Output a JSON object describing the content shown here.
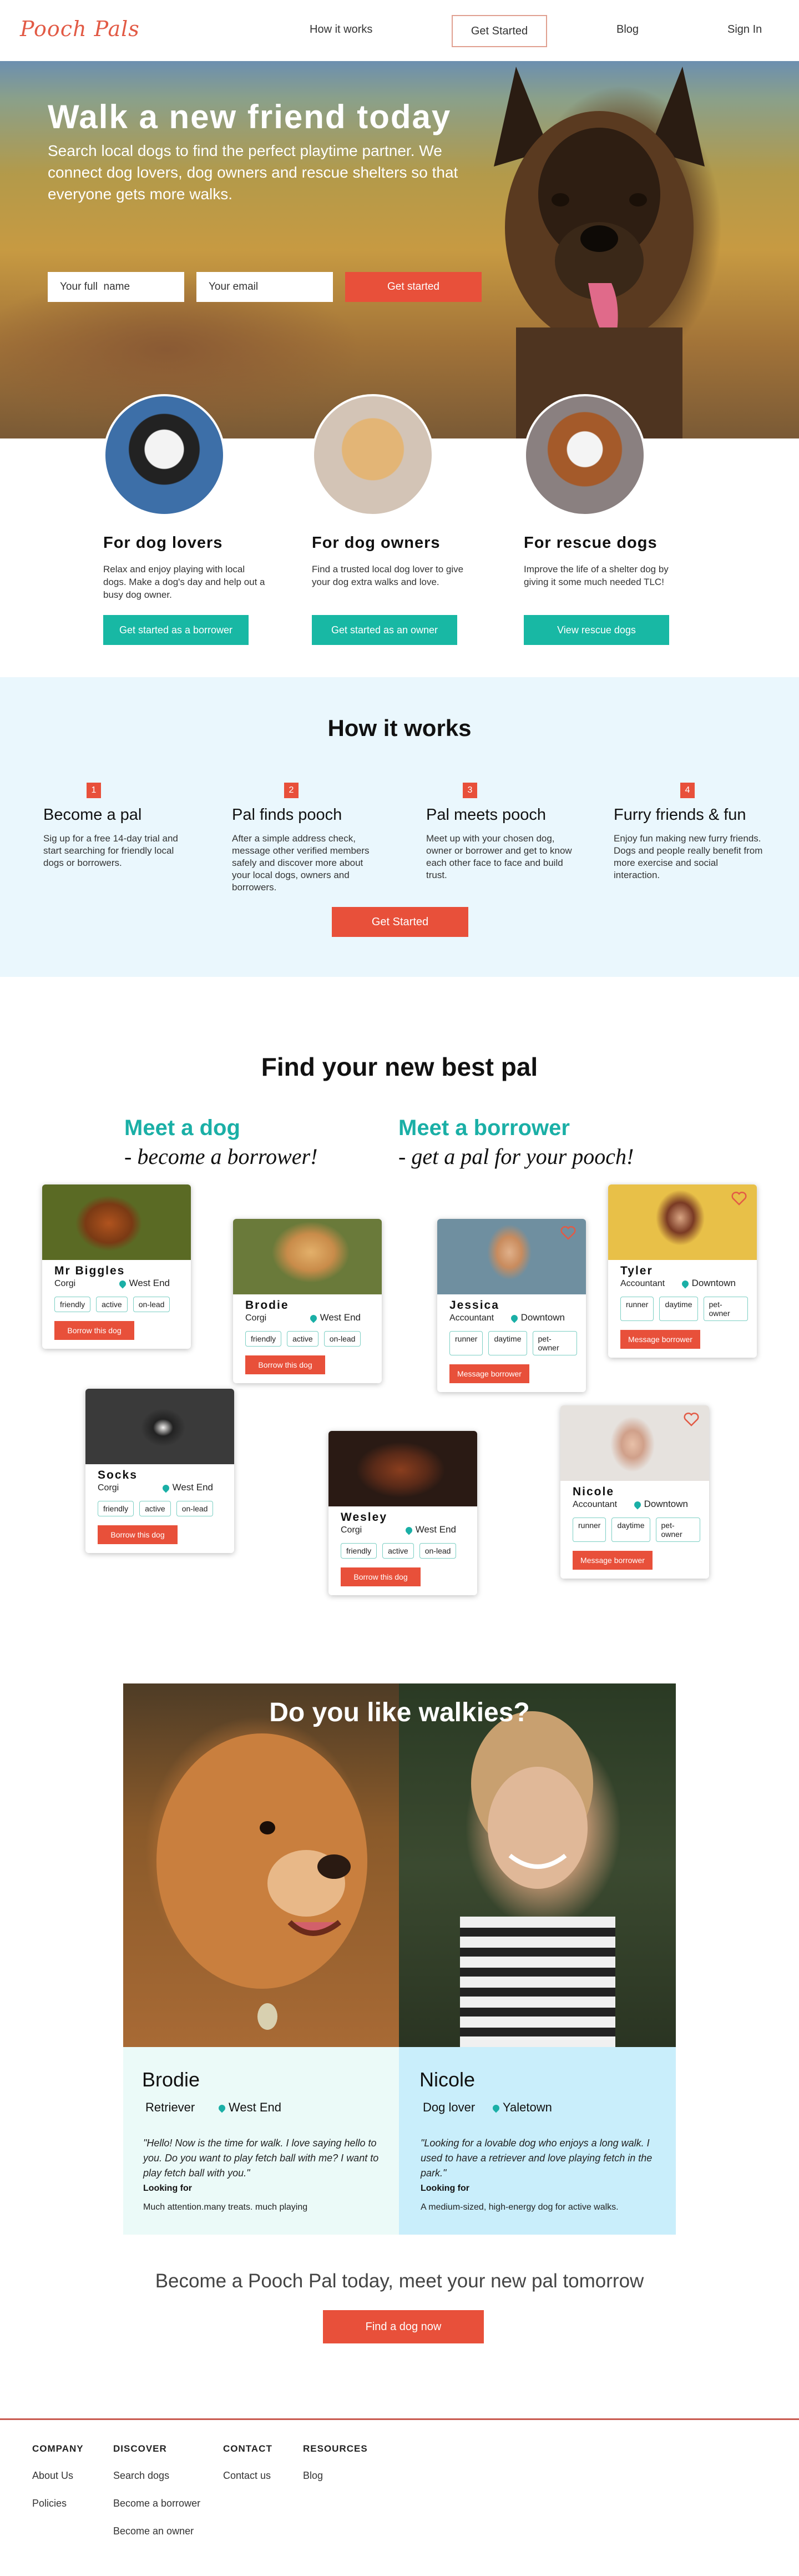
{
  "nav": {
    "logo": "Pooch Pals",
    "how_it_works": "How it works",
    "get_started": "Get Started",
    "blog": "Blog",
    "sign_in": "Sign In"
  },
  "hero": {
    "title": "Walk a new friend today",
    "subtitle": "Search local dogs to find the perfect playtime partner. We connect dog lovers, dog owners and rescue shelters so that everyone gets more walks.",
    "name_placeholder": "Your full  name",
    "email_placeholder": "Your email",
    "button": "Get started"
  },
  "audiences": [
    {
      "title": "For dog lovers",
      "text": "Relax and enjoy playing with local dogs. Make a dog's day and help out a busy dog owner.",
      "button": "Get started as a borrower"
    },
    {
      "title": "For dog owners",
      "text": "Find a trusted local dog lover to give your dog extra walks and love.",
      "button": "Get started as an owner"
    },
    {
      "title": "For rescue dogs",
      "text": "Improve the life of a shelter dog by giving it some much needed TLC!",
      "button": "View rescue dogs"
    }
  ],
  "how": {
    "title": "How it works",
    "steps": [
      {
        "num": "1",
        "title": "Become a pal",
        "text": "Sig up for a free 14-day trial and start searching for friendly local dogs or borrowers."
      },
      {
        "num": "2",
        "title": "Pal finds pooch",
        "text": "After a simple address check, message other verified members safely and discover more about your local dogs, owners and borrowers."
      },
      {
        "num": "3",
        "title": "Pal meets pooch",
        "text": "Meet up with your chosen dog, owner or borrower and get to know each other face to face and build trust."
      },
      {
        "num": "4",
        "title": "Furry friends & fun",
        "text": "Enjoy fun making new furry friends. Dogs and people really benefit from more exercise and social interaction."
      }
    ],
    "button": "Get Started"
  },
  "find": {
    "title": "Find your new best pal",
    "meet_dog": "Meet a dog",
    "meet_dog_sub": "- become a borrower!",
    "meet_borrower": "Meet a borrower",
    "meet_borrower_sub": "- get a pal for your pooch!",
    "dogs": [
      {
        "name": "Mr Biggles",
        "breed": "Corgi",
        "loc": "West End",
        "tags": [
          "friendly",
          "active",
          "on-lead"
        ],
        "button": "Borrow this dog"
      },
      {
        "name": "Brodie",
        "breed": "Corgi",
        "loc": "West End",
        "tags": [
          "friendly",
          "active",
          "on-lead"
        ],
        "button": "Borrow this dog"
      },
      {
        "name": "Socks",
        "breed": "Corgi",
        "loc": "West End",
        "tags": [
          "friendly",
          "active",
          "on-lead"
        ],
        "button": "Borrow this dog"
      },
      {
        "name": "Wesley",
        "breed": "Corgi",
        "loc": "West End",
        "tags": [
          "friendly",
          "active",
          "on-lead"
        ],
        "button": "Borrow this dog"
      }
    ],
    "borrowers": [
      {
        "name": "Jessica",
        "role": "Accountant",
        "loc": "Downtown",
        "tags": [
          "runner",
          "daytime",
          "pet-owner"
        ],
        "button": "Message borrower"
      },
      {
        "name": "Tyler",
        "role": "Accountant",
        "loc": "Downtown",
        "tags": [
          "runner",
          "daytime",
          "pet-owner"
        ],
        "button": "Message borrower"
      },
      {
        "name": "Nicole",
        "role": "Accountant",
        "loc": "Downtown",
        "tags": [
          "runner",
          "daytime",
          "pet-owner"
        ],
        "button": "Message borrower"
      }
    ]
  },
  "walkies": {
    "title": "Do you like walkies?",
    "left": {
      "name": "Brodie",
      "role": "Retriever",
      "loc": "West End",
      "quote": "\"Hello!  Now is the time for walk. I love saying hello to you. Do you want to play fetch ball with me?  I want to play fetch ball with you.\"",
      "look_label": "Looking for",
      "look_text": "Much attention.many treats. much playing"
    },
    "right": {
      "name": "Nicole",
      "role": "Dog lover",
      "loc": "Yaletown",
      "quote": "\"Looking for a lovable dog who enjoys a long walk. I used to have a retriever and love playing fetch in the park.\"",
      "look_label": "Looking for",
      "look_text": "A medium-sized, high-energy dog for active walks."
    }
  },
  "cta": {
    "title": "Become a Pooch Pal today, meet your new pal tomorrow",
    "button": "Find a dog now"
  },
  "footer": {
    "company": {
      "heading": "COMPANY",
      "links": [
        "About Us",
        "Policies"
      ]
    },
    "discover": {
      "heading": "DISCOVER",
      "links": [
        "Search dogs",
        "Become a borrower",
        "Become an owner"
      ]
    },
    "contact": {
      "heading": "CONTACT",
      "links": [
        "Contact us"
      ]
    },
    "resources": {
      "heading": "RESOURCES",
      "links": [
        "Blog"
      ]
    }
  },
  "colors": {
    "brand": "#e25a45",
    "button_red": "#e8503a",
    "teal": "#1aafa6",
    "light_blue": "#eaf7fd"
  }
}
